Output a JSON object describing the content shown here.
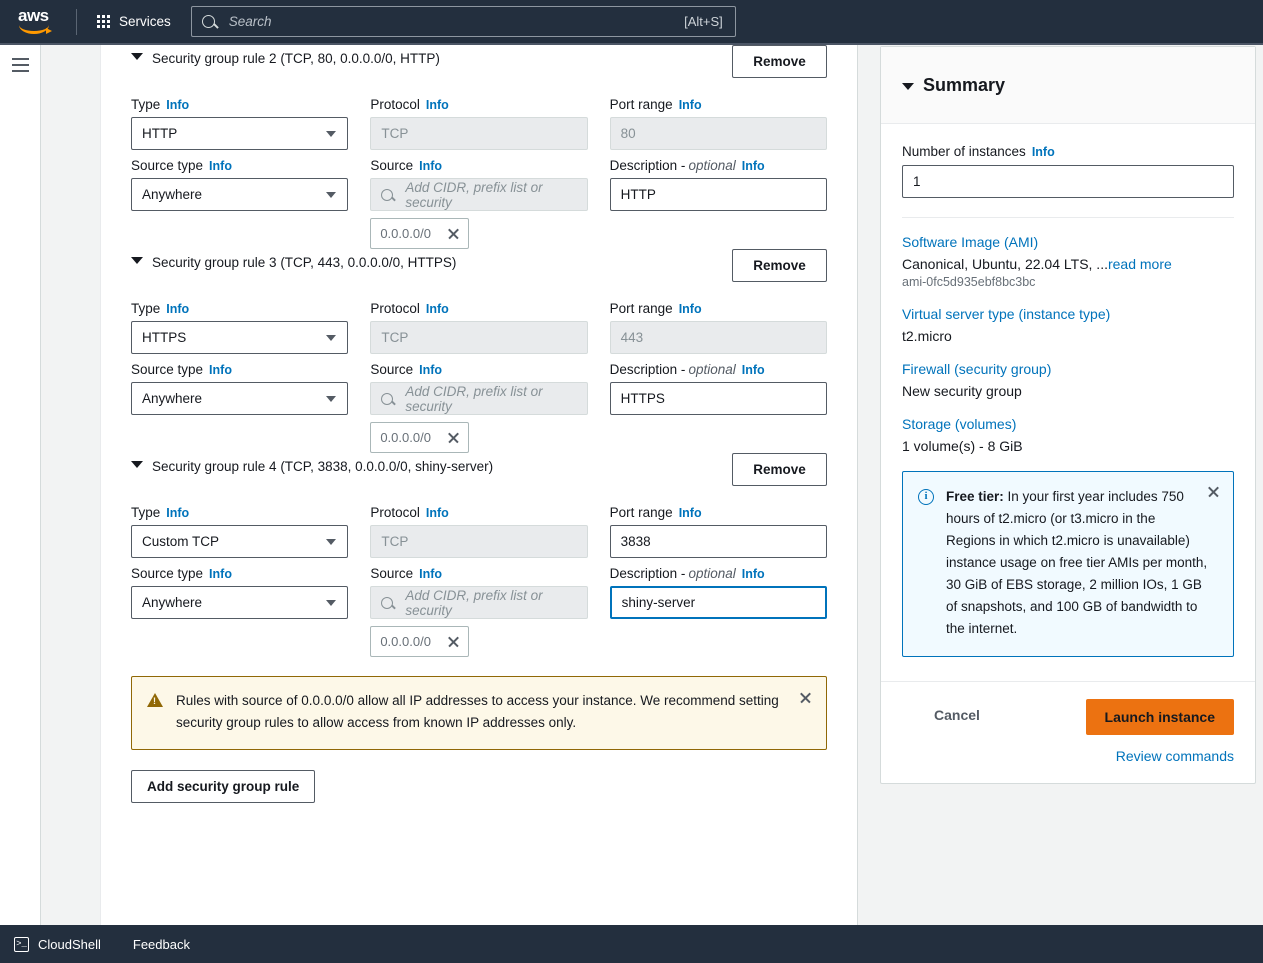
{
  "topnav": {
    "logo_text": "aws",
    "services_label": "Services",
    "search_placeholder": "Search",
    "search_shortcut": "[Alt+S]",
    "search_icon": "search-icon",
    "grid_icon": "app-grid-icon"
  },
  "labels": {
    "type": "Type",
    "protocol": "Protocol",
    "port_range": "Port range",
    "source_type": "Source type",
    "source": "Source",
    "description": "Description - ",
    "description_optional": "optional",
    "info": "Info",
    "remove": "Remove",
    "source_placeholder": "Add CIDR, prefix list or security"
  },
  "rules": [
    {
      "title": "Security group rule 2 (TCP, 80, 0.0.0.0/0, HTTP)",
      "type": "HTTP",
      "protocol": "TCP",
      "port": "80",
      "source_type": "Anywhere",
      "source_token": "0.0.0.0/0",
      "description": "HTTP",
      "port_disabled": true,
      "desc_focused": false
    },
    {
      "title": "Security group rule 3 (TCP, 443, 0.0.0.0/0, HTTPS)",
      "type": "HTTPS",
      "protocol": "TCP",
      "port": "443",
      "source_type": "Anywhere",
      "source_token": "0.0.0.0/0",
      "description": "HTTPS",
      "port_disabled": true,
      "desc_focused": false
    },
    {
      "title": "Security group rule 4 (TCP, 3838, 0.0.0.0/0, shiny-server)",
      "type": "Custom TCP",
      "protocol": "TCP",
      "port": "3838",
      "source_type": "Anywhere",
      "source_token": "0.0.0.0/0",
      "description": "shiny-server",
      "port_disabled": false,
      "desc_focused": true
    }
  ],
  "warning": {
    "text": "Rules with source of 0.0.0.0/0 allow all IP addresses to access your instance. We recommend setting security group rules to allow access from known IP addresses only.",
    "icon": "warning-triangle-icon",
    "close_icon": "close-icon"
  },
  "add_rule_button": "Add security group rule",
  "summary": {
    "title": "Summary",
    "caret_icon": "chevron-down-icon",
    "number_of_instances_label": "Number of instances",
    "number_of_instances_value": "1",
    "items": [
      {
        "link": "Software Image (AMI)",
        "value": "Canonical, Ubuntu, 22.04 LTS, ...",
        "read_more": "read more",
        "sub": "ami-0fc5d935ebf8bc3bc"
      },
      {
        "link": "Virtual server type (instance type)",
        "value": "t2.micro",
        "read_more": "",
        "sub": ""
      },
      {
        "link": "Firewall (security group)",
        "value": "New security group",
        "read_more": "",
        "sub": ""
      },
      {
        "link": "Storage (volumes)",
        "value": "1 volume(s) - 8 GiB",
        "read_more": "",
        "sub": ""
      }
    ],
    "free_tier_label": "Free tier:",
    "free_tier_text": " In your first year includes 750 hours of t2.micro (or t3.micro in the Regions in which t2.micro is unavailable) instance usage on free tier AMIs per month, 30 GiB of EBS storage, 2 million IOs, 1 GB of snapshots, and 100 GB of bandwidth to the internet.",
    "free_tier_icon": "info-circle-icon",
    "free_tier_close_icon": "close-icon",
    "cancel_label": "Cancel",
    "launch_label": "Launch instance",
    "review_commands_label": "Review commands"
  },
  "bottombar": {
    "cloudshell_label": "CloudShell",
    "cloudshell_icon": "terminal-icon",
    "feedback_label": "Feedback"
  },
  "colors": {
    "nav_bg": "#232f3e",
    "link": "#0073bb",
    "launch_orange": "#ec7211",
    "warning_border": "#906806",
    "warning_bg": "#fdf8e8",
    "info_bg": "#f1faff"
  }
}
